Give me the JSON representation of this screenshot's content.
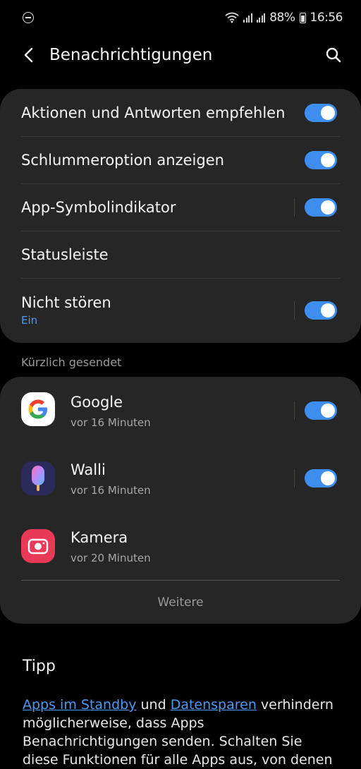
{
  "status_bar": {
    "battery": "88%",
    "time": "16:56"
  },
  "header": {
    "title": "Benachrichtigungen"
  },
  "settings": [
    {
      "label": "Aktionen und Antworten empfehlen",
      "toggle": true
    },
    {
      "label": "Schlummeroption anzeigen",
      "toggle": true
    },
    {
      "label": "App-Symbolindikator",
      "toggle": true
    },
    {
      "label": "Statusleiste",
      "toggle": false
    },
    {
      "label": "Nicht stören",
      "sublabel": "Ein",
      "toggle": true
    }
  ],
  "recent": {
    "section_label": "Kürzlich gesendet",
    "apps": [
      {
        "name": "Google",
        "time": "vor 16 Minuten",
        "toggle": true,
        "icon": "google-icon"
      },
      {
        "name": "Walli",
        "time": "vor 16 Minuten",
        "toggle": true,
        "icon": "walli-icon"
      },
      {
        "name": "Kamera",
        "time": "vor 20 Minuten",
        "toggle": false,
        "icon": "camera-icon"
      }
    ],
    "more_label": "Weitere"
  },
  "tip": {
    "title": "Tipp",
    "link1": "Apps im Standby",
    "and": " und ",
    "link2": "Datensparen",
    "body": " verhindern möglicherweise, dass Apps Benachrichtigungen senden. Schalten Sie diese Funktionen für alle Apps aus, von denen"
  },
  "colors": {
    "accent": "#3e8ef0",
    "link": "#4a9bf5",
    "card": "#262626"
  }
}
